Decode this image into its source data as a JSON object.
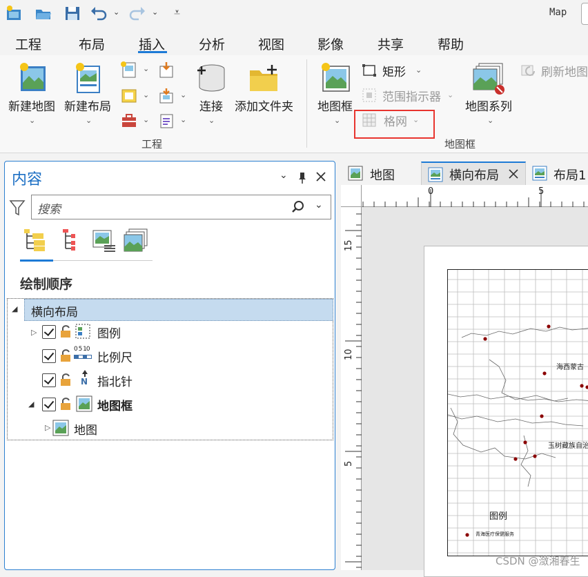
{
  "title_bar": {
    "app_name": "Map"
  },
  "quick_access": {
    "icons": [
      "new-project-icon",
      "open-project-icon",
      "save-project-icon",
      "undo-icon",
      "redo-icon",
      "customize-qat-icon"
    ]
  },
  "ribbon_tabs": [
    "工程",
    "布局",
    "插入",
    "分析",
    "视图",
    "影像",
    "共享",
    "帮助"
  ],
  "active_tab": "插入",
  "ribbon": {
    "project_group": {
      "label": "工程",
      "new_map": "新建地图",
      "new_layout": "新建布局",
      "connect": "连接",
      "add_folder": "添加文件夹"
    },
    "map_frame_group": {
      "label": "地图框",
      "map_frame": "地图框",
      "rectangle": "矩形",
      "extent_indicator": "范围指示器",
      "grid": "格网",
      "map_series": "地图系列",
      "refresh_map": "刷新地图"
    }
  },
  "contents_pane": {
    "title": "内容",
    "search_placeholder": "搜索",
    "section_label": "绘制顺序",
    "root": "横向布局",
    "items": [
      {
        "label": "图例",
        "checked": true
      },
      {
        "label": "比例尺",
        "checked": true
      },
      {
        "label": "指北针",
        "checked": true
      },
      {
        "label": "地图框",
        "checked": true,
        "bold": true
      },
      {
        "label": "地图"
      }
    ],
    "scale_icon_text": "0 5 10",
    "north_icon_text": "N"
  },
  "doc_tabs": [
    {
      "label": "地图",
      "active": false
    },
    {
      "label": "横向布局",
      "active": true
    },
    {
      "label": "布局1",
      "active": false
    }
  ],
  "layout_view": {
    "ruler_h_labels": [
      "0",
      "5"
    ],
    "ruler_v_labels": [
      "15",
      "10",
      "5"
    ],
    "map_labels": [
      "海西蒙古",
      "玉树藏族自治"
    ],
    "legend_title": "图例",
    "legend_item": "青海医疗保健服务"
  },
  "watermark": "CSDN @潋湘春生",
  "colors": {
    "accent": "#1c7ad6",
    "highlight_box": "#e8342e",
    "selection": "#c5dbef"
  }
}
